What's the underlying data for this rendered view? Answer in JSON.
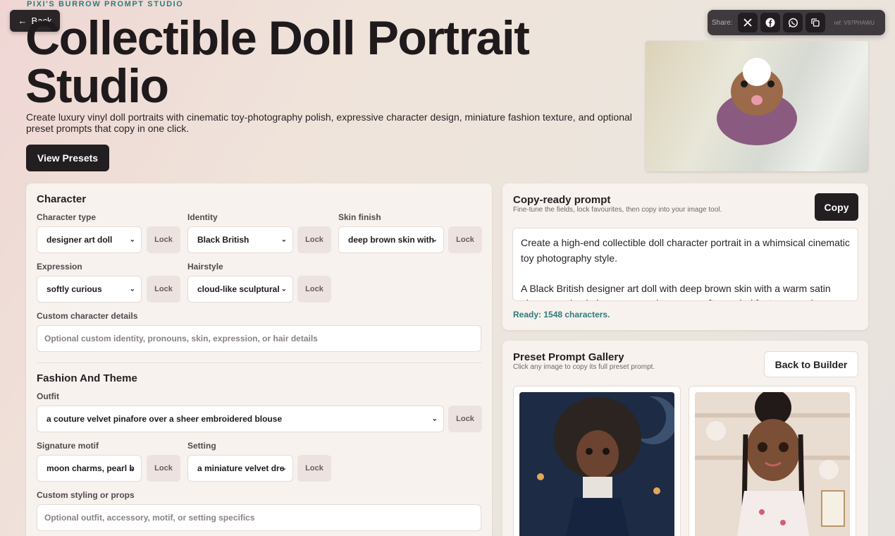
{
  "brand": "PIXI'S BURROW PROMPT STUDIO",
  "back_label": "Back",
  "hero": {
    "title": "Collectible Doll Portrait Studio",
    "subtitle": "Create luxury vinyl doll portraits with cinematic toy-photography polish, expressive character design, miniature fashion texture, and optional preset prompts that copy in one click.",
    "view_presets": "View Presets"
  },
  "share": {
    "label": "Share:",
    "x": "X",
    "facebook": "f",
    "whatsapp": "◉",
    "copy": "⧉",
    "ref": "ref: V97PHAWU"
  },
  "character": {
    "title": "Character",
    "character_type_label": "Character type",
    "character_type_value": "designer art doll",
    "identity_label": "Identity",
    "identity_value": "Black British",
    "skin_label": "Skin finish",
    "skin_value": "deep brown skin with",
    "expression_label": "Expression",
    "expression_value": "softly curious",
    "hairstyle_label": "Hairstyle",
    "hairstyle_value": "cloud-like sculptural",
    "custom_label": "Custom character details",
    "custom_placeholder": "Optional custom identity, pronouns, skin, expression, or hair details",
    "lock": "Lock"
  },
  "fashion": {
    "title": "Fashion And Theme",
    "outfit_label": "Outfit",
    "outfit_value": "a couture velvet pinafore over a sheer embroidered blouse",
    "motif_label": "Signature motif",
    "motif_value": "moon charms, pearl b",
    "setting_label": "Setting",
    "setting_value": "a miniature velvet dre",
    "custom_label": "Custom styling or props",
    "custom_placeholder": "Optional outfit, accessory, motif, or setting specifics",
    "lock": "Lock"
  },
  "prompt": {
    "title": "Copy-ready prompt",
    "subtitle": "Fine-tune the fields, lock favourites, then copy into your image tool.",
    "copy": "Copy",
    "text": "Create a high-end collectible doll character portrait in a whimsical cinematic toy photography style.\n\nA Black British designer art doll with deep brown skin with a warm satin glow, oversized glossy expressive eyes, soft rounded features, and a",
    "ready": "Ready: 1548 characters."
  },
  "gallery": {
    "title": "Preset Prompt Gallery",
    "subtitle": "Click any image to copy its full preset prompt.",
    "back": "Back to Builder"
  },
  "colors": {
    "accent": "#2f7b78",
    "dark_button": "#231e20",
    "panel": "#f7f2ee"
  }
}
